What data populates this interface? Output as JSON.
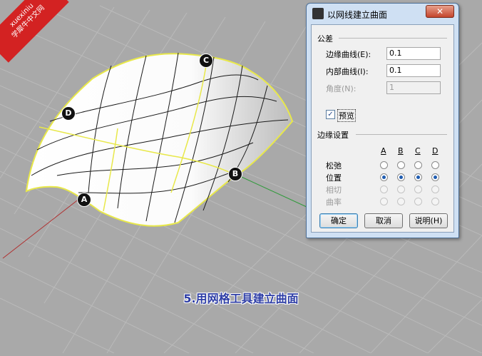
{
  "watermark": {
    "line1": "xuexiniu",
    "line2": "学犀牛中文网"
  },
  "caption": "5.用网格工具建立曲面",
  "points": [
    "A",
    "B",
    "C",
    "D"
  ],
  "dialog": {
    "title": "以网线建立曲面",
    "close_label": "✕",
    "tolerance": {
      "header": "公差",
      "edge_label": "边缘曲线(E):",
      "edge_value": "0.1",
      "interior_label": "内部曲线(I):",
      "interior_value": "0.1",
      "angle_label": "角度(N):",
      "angle_value": "1"
    },
    "preview_label": "预览",
    "preview_checked": true,
    "edge_settings": {
      "header": "边缘设置",
      "columns": [
        "A",
        "B",
        "C",
        "D"
      ],
      "rows": [
        {
          "label": "松弛",
          "enabled": true
        },
        {
          "label": "位置",
          "enabled": true
        },
        {
          "label": "相切",
          "enabled": false
        },
        {
          "label": "曲率",
          "enabled": false
        }
      ],
      "selected_row": "位置"
    },
    "buttons": {
      "ok": "确定",
      "cancel": "取消",
      "help": "说明(H)"
    }
  },
  "colors": {
    "viewport_bg": "#a9a9a9",
    "grid": "#bababa",
    "x_axis": "#b03030",
    "y_axis": "#2f9a3a",
    "surface_edge": "#e8e84a",
    "caption": "#2e3ea6"
  }
}
